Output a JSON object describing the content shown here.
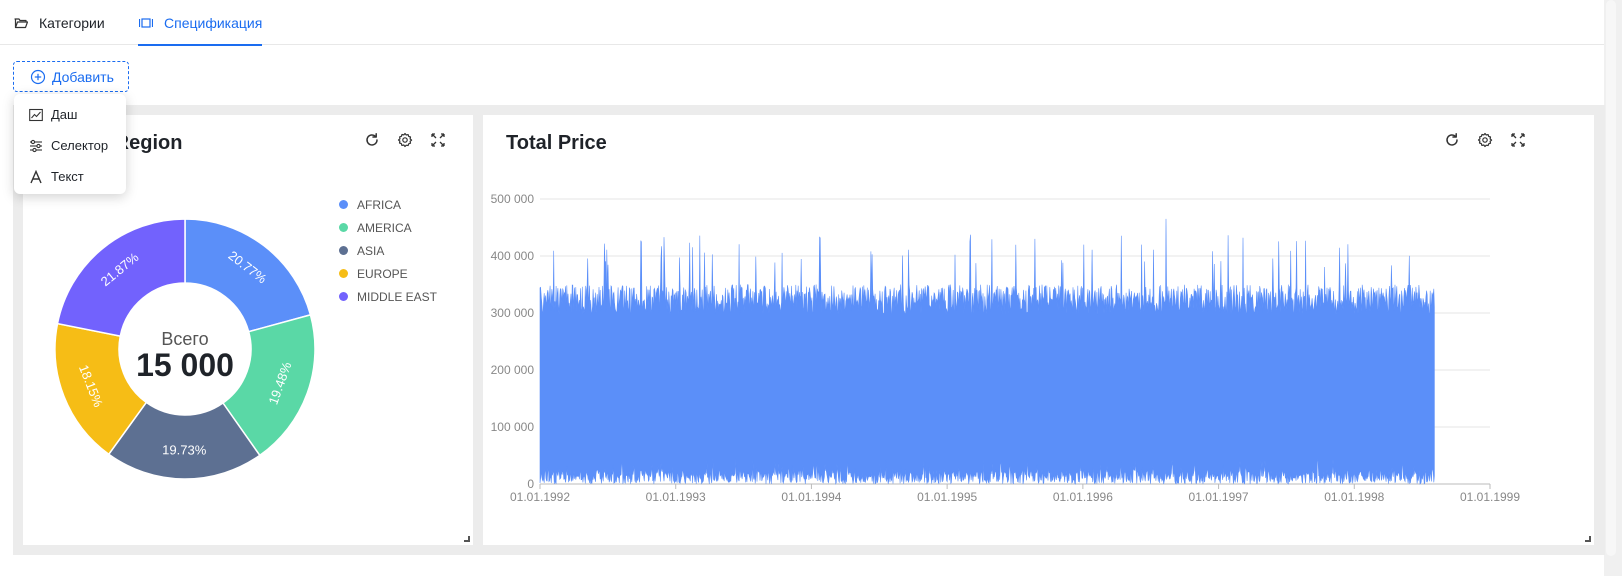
{
  "tabs": [
    {
      "label": "Категории",
      "icon": "folder-open-icon",
      "active": false
    },
    {
      "label": "Спецификация",
      "icon": "column-width-icon",
      "active": true
    }
  ],
  "add_button": {
    "label": "Добавить",
    "icon": "plus-circle-icon"
  },
  "add_menu": [
    {
      "label": "Даш",
      "icon": "line-chart-icon"
    },
    {
      "label": "Селектор",
      "icon": "sliders-icon"
    },
    {
      "label": "Текст",
      "icon": "font-icon"
    }
  ],
  "colors": {
    "accent": "#1a6cf0",
    "series": "#5b8ff9"
  },
  "pie_card": {
    "title_visible": "y Region",
    "center_label": "Всего",
    "center_value": "15 000",
    "tools": [
      "reload-icon",
      "setting-icon",
      "fullscreen-icon"
    ]
  },
  "price_card": {
    "title": "Total Price",
    "tools": [
      "reload-icon",
      "setting-icon",
      "fullscreen-icon"
    ]
  },
  "chart_data": [
    {
      "type": "pie",
      "title": "",
      "center_label": "Всего",
      "center_value": "15 000",
      "categories": [
        "AFRICA",
        "AMERICA",
        "ASIA",
        "EUROPE",
        "MIDDLE EAST"
      ],
      "values": [
        20.77,
        19.48,
        19.73,
        18.15,
        21.87
      ],
      "data_labels": [
        "20.77%",
        "19.48%",
        "19.73%",
        "18.15%",
        "21.87%"
      ],
      "colors": [
        "#5b8ff9",
        "#5ad8a6",
        "#5d7092",
        "#f6bd16",
        "#7262fd"
      ],
      "legend": "top-right"
    },
    {
      "type": "area",
      "title": "Total Price",
      "xlabel": "",
      "ylabel": "",
      "x_ticks": [
        "01.01.1992",
        "01.01.1993",
        "01.01.1994",
        "01.01.1995",
        "01.01.1996",
        "01.01.1997",
        "01.01.1998",
        "01.01.1999"
      ],
      "y_ticks": [
        "0",
        "100 000",
        "200 000",
        "300 000",
        "400 000",
        "500 000"
      ],
      "ylim": [
        0,
        500000
      ],
      "xlim": [
        "01.01.1992",
        "01.01.1999"
      ],
      "x_data_range": [
        "01.01.1992",
        "02.08.1998"
      ],
      "peak_value": 465000,
      "typical_high": 350000,
      "typical_low": 10000,
      "grid": true,
      "series": [
        {
          "color": "#5b8ff9"
        }
      ]
    }
  ]
}
